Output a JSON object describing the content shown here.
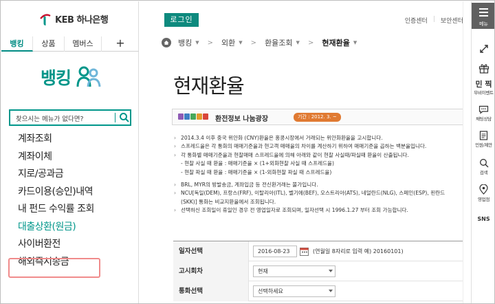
{
  "brand": {
    "name": "KEB 하나은행"
  },
  "sidebar": {
    "tabs": [
      {
        "label": "뱅킹"
      },
      {
        "label": "상품"
      },
      {
        "label": "멤버스"
      },
      {
        "label": "+"
      }
    ],
    "section_title": "뱅킹",
    "search_placeholder": "찾으시는 메뉴가 없다면?",
    "menu": [
      {
        "label": "계좌조회"
      },
      {
        "label": "계좌이체"
      },
      {
        "label": "지로/공과금"
      },
      {
        "label": "카드이용(승인)내역"
      },
      {
        "label": "내 펀드 수익률 조회"
      },
      {
        "label": "대출상환(원금)"
      },
      {
        "label": "사이버환전"
      },
      {
        "label": "해외즉시송금"
      }
    ],
    "active_index": 5,
    "highlighted_index": 6
  },
  "header": {
    "login_label": "로그인",
    "links": [
      "인증센터",
      "보안센터"
    ]
  },
  "breadcrumb": [
    {
      "label": "뱅킹"
    },
    {
      "label": "외환"
    },
    {
      "label": "환율조회"
    },
    {
      "label": "현재환율"
    }
  ],
  "page_title": "현재환율",
  "notice": {
    "title": "환전정보 나눔광장",
    "badge": "기간 : 2012. 3. ~"
  },
  "info_lines": [
    "2014.3.4 이후 중국 위안화 (CNY)환율은 홍콩시장에서 거래되는 위안화환율을 고시합니다.",
    "스프레드율은 각 통화의 매매기준율과 현고객 매매율의 차이를 계산하기 위하여 매매기준을 곱하는 백분율입니다.",
    "각 통화별 매매기준율과 현찰매매 스프레드율에 의해 아래와 같이 현찰 사실때/파실때 환율이 산출됩니다.",
    "- 현찰 사실 때 환율 : 매매기준율 × (1+외화현찰 사실 때 스프레드율)",
    "- 현찰 파실 때 환율 : 매매기준율 × (1-외화현찰 파실 때 스프레드율)",
    "",
    "BRL, MYR의 방발송금, 계좌입금 등 전신환거래는 불가입니다.",
    "NCU[독일(DEM), 프랑스(FRF), 이탈리아(ITL), 벨기에(BEF), 오스트리아(ATS), 네덜란드(NLG), 스페인(ESP), 핀란드",
    "(SKK)] 통화는 비교지환율에서 조회됩니다.",
    "선택하신 조회일이 휴일인 경우 전 영업일자로 조회되며, 일자선택 시 1996.1.27 부터 조회 가능합니다."
  ],
  "form": {
    "date_label": "일자선택",
    "date_value": "2016-08-23",
    "date_hint": "(연월일 8자리로 입력 예) 20160101)",
    "notice_round_label": "고시회차",
    "notice_round_value": "현재",
    "currency_label": "통화선택",
    "currency_value": "선택하세요"
  },
  "quickbar": {
    "menu_label": "메뉴",
    "items": [
      {
        "label": ""
      },
      {
        "label": ""
      },
      {
        "label": "무비이벤트"
      },
      {
        "label": "채팅상담"
      },
      {
        "label": "민원/제안"
      },
      {
        "label": "검색"
      },
      {
        "label": "영업점"
      },
      {
        "label": "SNS"
      }
    ],
    "mubi_logo_text": "민 찍"
  },
  "colors": {
    "accent": "#00968a",
    "login_bg": "#0e8a7e",
    "highlight": "#f08b8b",
    "quick_menu_bg": "#606060"
  }
}
